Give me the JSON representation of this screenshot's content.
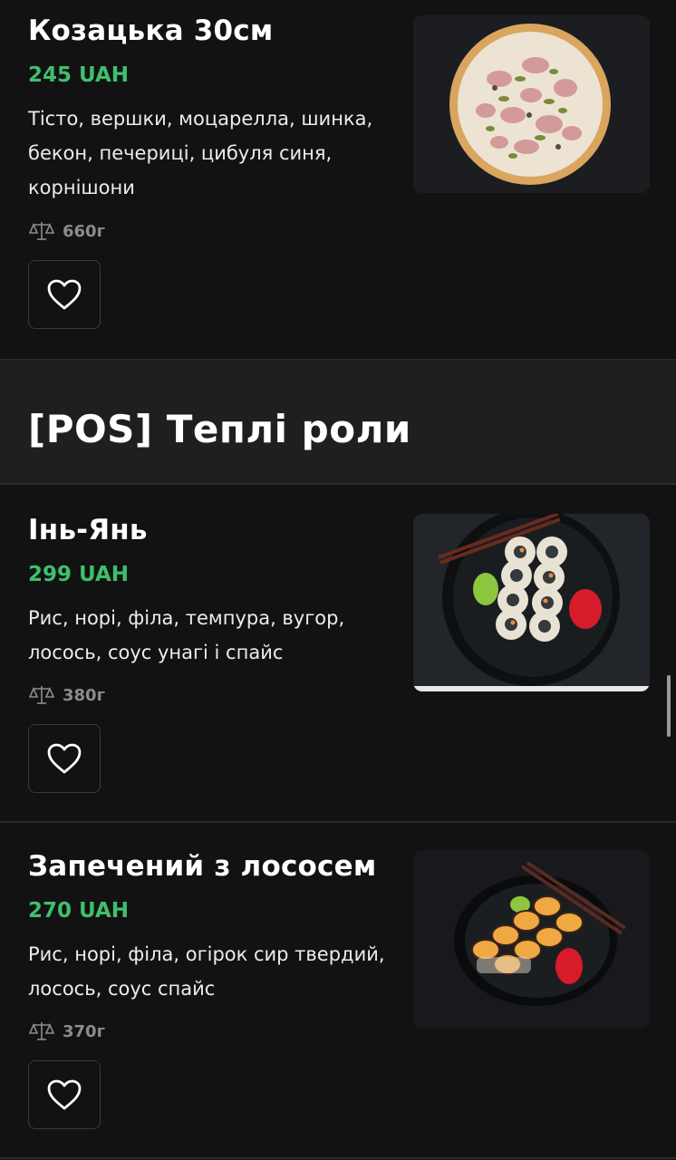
{
  "items_top": {
    "title": "Козацька 30см",
    "price": "245 UAH",
    "description": "Тісто, вершки, моцарелла, шинка, бекон, печериці, цибуля синя, корнішони",
    "weight": "660г",
    "image_icon": "pizza-photo"
  },
  "section": {
    "title": "[POS] Теплі роли"
  },
  "items": [
    {
      "title": "Інь-Янь",
      "price": "299 UAH",
      "description": "Рис, норі, філа, темпура, вугор, лосось, соус унагі і спайс",
      "weight": "380г",
      "image_icon": "sushi-roll-photo"
    },
    {
      "title": "Запечений з лососем",
      "price": "270 UAH",
      "description": "Рис, норі, філа, огірок сир твердий, лосось, соус спайс",
      "weight": "370г",
      "image_icon": "baked-roll-photo"
    }
  ],
  "colors": {
    "background": "#121212",
    "section_background": "#1f1f1f",
    "price": "#3fbf6c",
    "muted": "#8c8c8c"
  },
  "icons": {
    "favorite": "heart-outline-icon",
    "weight": "scales-icon"
  }
}
